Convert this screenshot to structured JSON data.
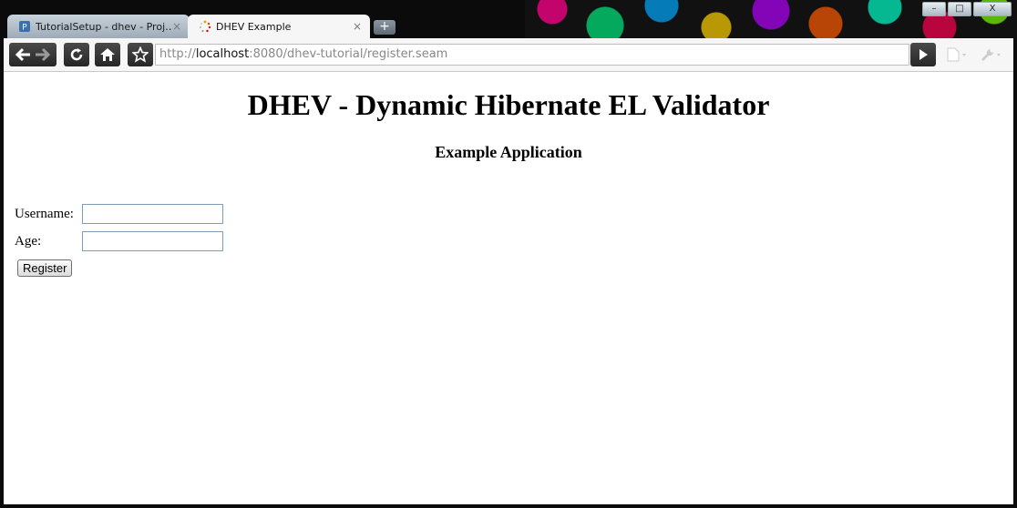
{
  "window": {
    "controls": {
      "minimize": "–",
      "maximize": "□",
      "close": "X"
    }
  },
  "tabs": [
    {
      "title": "TutorialSetup - dhev - Proj…",
      "close": "×",
      "favicon": "project-icon",
      "active": false
    },
    {
      "title": "DHEV Example",
      "close": "×",
      "favicon": "loading-spinner-icon",
      "active": true
    }
  ],
  "new_tab_label": "+",
  "toolbar": {
    "back_icon": "back-arrow-icon",
    "forward_icon": "forward-arrow-icon",
    "reload_icon": "reload-icon",
    "home_icon": "home-icon",
    "bookmark_icon": "star-icon",
    "url_scheme": "http://",
    "url_host": "localhost",
    "url_rest": ":8080/dhev-tutorial/register.seam",
    "go_icon": "go-arrow-icon",
    "page_menu_icon": "page-menu-icon",
    "tools_menu_icon": "wrench-icon"
  },
  "page": {
    "title": "DHEV - Dynamic Hibernate EL Validator",
    "subtitle": "Example Application",
    "form": {
      "username_label": "Username:",
      "username_value": "",
      "age_label": "Age:",
      "age_value": "",
      "submit_label": "Register"
    }
  },
  "colors": {
    "toolbar_bg": "#f6f6f6",
    "input_border": "#7f9db9",
    "frame": "#0b0b0b"
  }
}
